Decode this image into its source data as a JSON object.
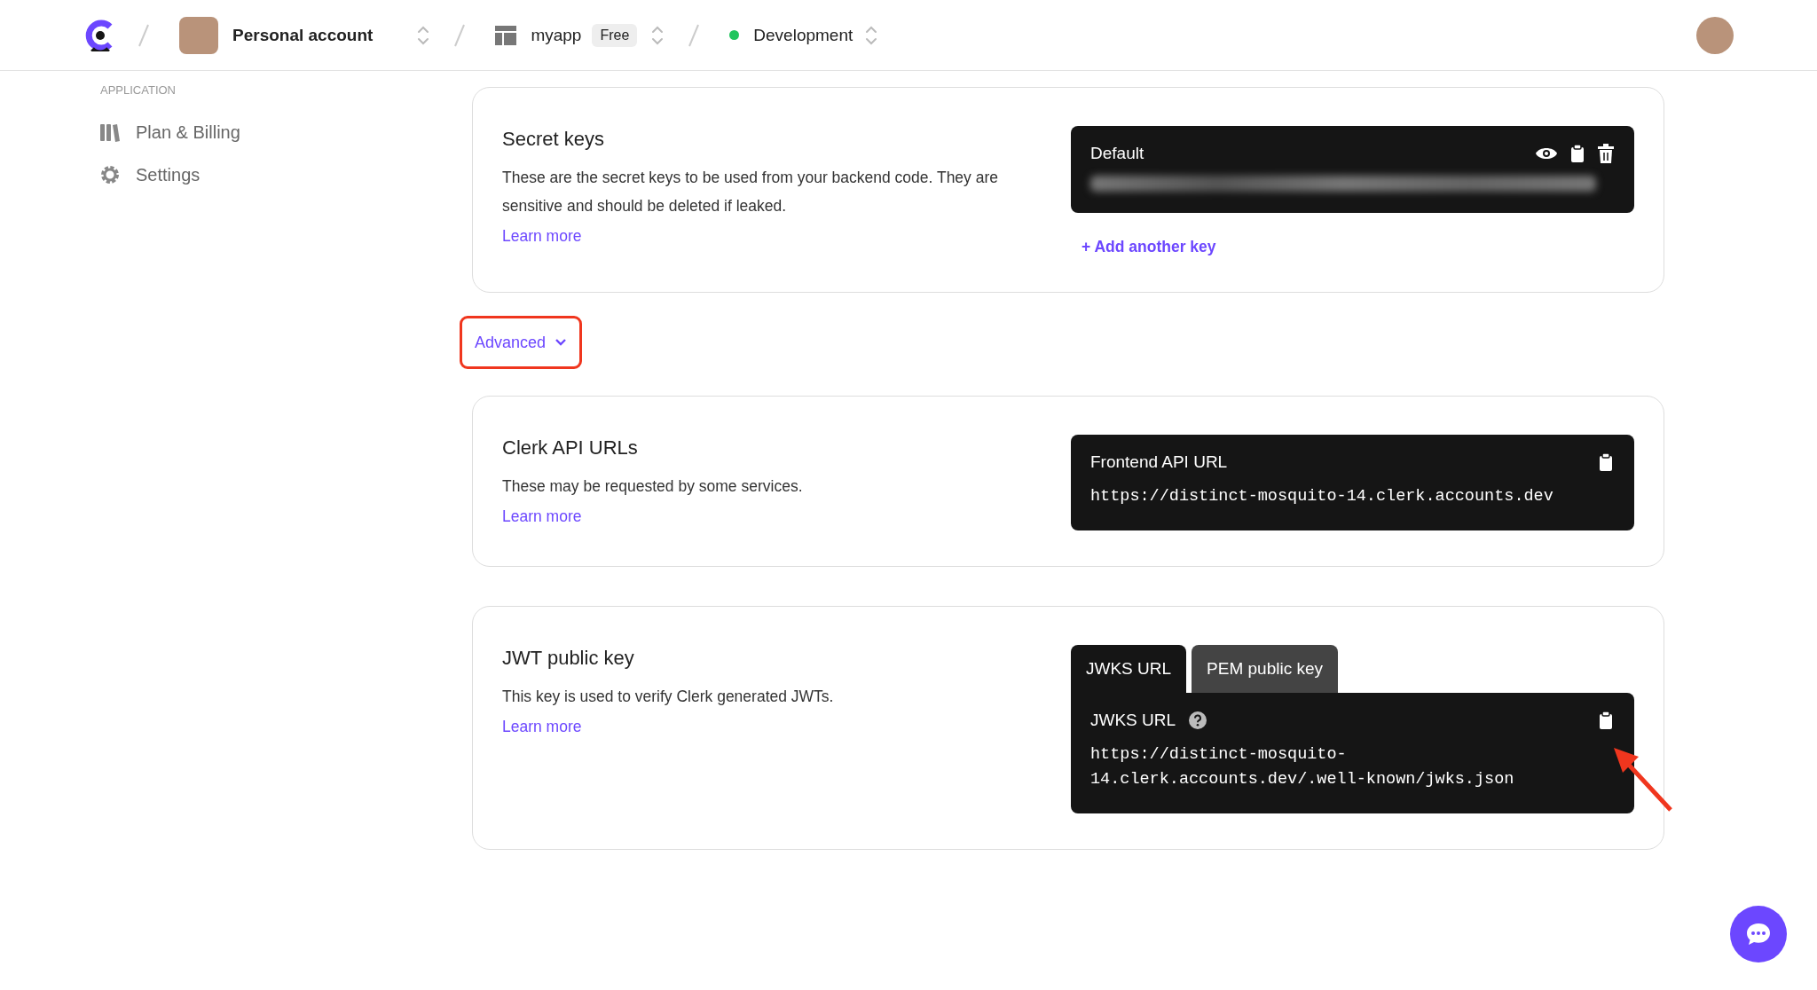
{
  "topbar": {
    "account": {
      "label": "Personal account"
    },
    "app": {
      "label": "myapp",
      "badge": "Free"
    },
    "environment": {
      "label": "Development"
    }
  },
  "sidebar": {
    "section": "APPLICATION",
    "items": [
      {
        "label": "Plan & Billing",
        "kind": "billing"
      },
      {
        "label": "Settings",
        "kind": "settings"
      }
    ]
  },
  "secret_keys": {
    "title": "Secret keys",
    "description": "These are the secret keys to be used from your backend code. They are sensitive and should be deleted if leaked.",
    "link": "Learn more",
    "key": {
      "name": "Default",
      "revealed": false
    },
    "add_link": "+ Add another key"
  },
  "advanced": {
    "label": "Advanced",
    "expanded": true
  },
  "api_urls": {
    "title": "Clerk API URLs",
    "description": "These may be requested by some services.",
    "link": "Learn more",
    "panel": {
      "title": "Frontend API URL",
      "value": "https://distinct-mosquito-14.clerk.accounts.dev"
    }
  },
  "jwt": {
    "title": "JWT public key",
    "description": "This key is used to verify Clerk generated JWTs.",
    "link": "Learn more",
    "tabs": [
      {
        "label": "JWKS URL",
        "selected": true
      },
      {
        "label": "PEM public key",
        "selected": false
      }
    ],
    "panel": {
      "title": "JWKS URL",
      "value": "https://distinct-mosquito-14.clerk.accounts.dev/.well-known/jwks.json"
    }
  }
}
